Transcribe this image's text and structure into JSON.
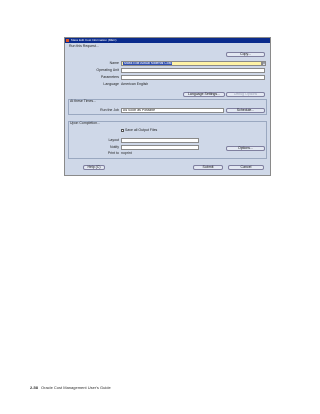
{
  "window": {
    "title": "Mass Edit Cost Information (MEC)",
    "section_run": "Run this Request...",
    "name_label": "Name",
    "name_value": "Mass Edit Actual Material Cost",
    "operating_unit_label": "Operating Unit",
    "parameters_label": "Parameters",
    "language_label": "Language",
    "language_value": "American English",
    "copy_button": "Copy...",
    "language_settings_button": "Language Settings...",
    "debug_options_button": "Debug Options",
    "section_times": "At these Times...",
    "run_job_label": "Run the Job",
    "run_job_value": "As Soon as Possible",
    "schedule_button": "Schedule...",
    "section_completion": "Upon Completion...",
    "save_output_label": "Save all Output Files",
    "layout_label": "Layout",
    "notify_label": "Notify",
    "print_to_label": "Print to",
    "print_to_value": "noprint",
    "options_button": "Options...",
    "help_button": "Help (C)",
    "submit_button": "Submit",
    "cancel_button": "Cancel"
  },
  "footer": {
    "page_number": "2-58",
    "guide_title": "Oracle Cost Management User's Guide"
  }
}
